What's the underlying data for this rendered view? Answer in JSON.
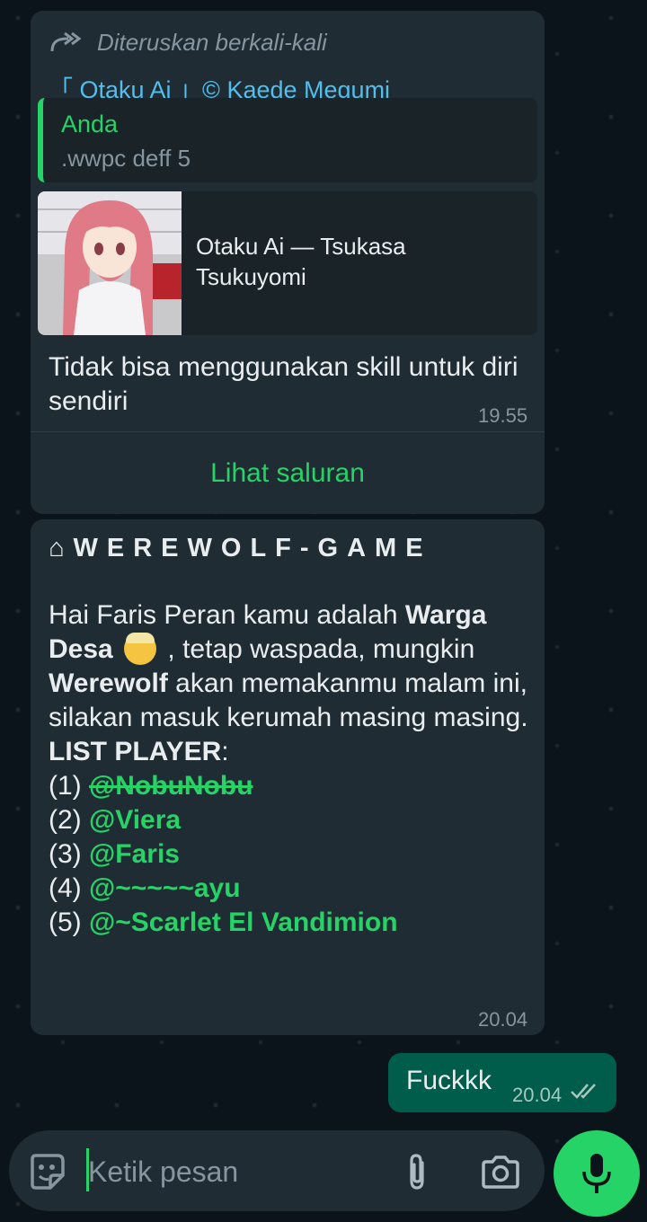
{
  "forwarded": {
    "label": "Diteruskan berkali-kali",
    "channel_name": "「 Otaku Ai 」© Kaede Megumi",
    "quote_author": "Anda",
    "quote_text": ".wwpc deff 5",
    "preview_title": "Otaku Ai — Tsukasa Tsukuyomi",
    "text": "Tidak bisa menggunakan skill untuk diri sendiri",
    "time": "19.55",
    "view_channel": "Lihat saluran"
  },
  "game_message": {
    "title": "⌂WEREWOLF-GAME",
    "intro_1": "Hai Faris Peran kamu adalah ",
    "role": "Warga Desa",
    "intro_2": " , tetap waspada, mungkin ",
    "werewolf": "Werewolf",
    "intro_3": " akan memakanmu malam ini, silakan masuk kerumah masing masing.",
    "list_header": "LIST PLAYER",
    "list_colon": ":",
    "players": [
      {
        "num": "(1) ",
        "name": "@NobuNobu"
      },
      {
        "num": "(2) ",
        "name": "@Viera"
      },
      {
        "num": "(3) ",
        "name": "@Faris"
      },
      {
        "num": "(4) ",
        "name": "@~~~~~ayu"
      },
      {
        "num": "(5) ",
        "name": "@~Scarlet El Vandimion"
      }
    ],
    "time": "20.04"
  },
  "outgoing": {
    "text": "Fuckkk",
    "time": "20.04"
  },
  "input": {
    "placeholder": "Ketik pesan"
  },
  "colors": {
    "background": "#0b141a",
    "incoming_bubble": "#202c33",
    "outgoing_bubble": "#005c4b",
    "accent_green": "#25d366",
    "link_blue": "#53bdeb"
  },
  "icons": [
    "forward-icon",
    "sticker-icon",
    "attach-icon",
    "camera-icon",
    "mic-icon",
    "double-check-icon"
  ]
}
